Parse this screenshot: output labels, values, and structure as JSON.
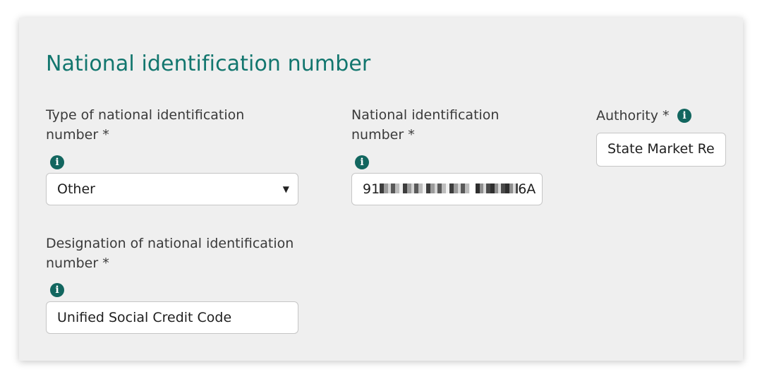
{
  "section": {
    "title": "National identification number"
  },
  "fields": {
    "type": {
      "label_line1": "Type of national identification",
      "label_line2": "number *",
      "info_icon": "info-icon",
      "value": "Other",
      "dropdown_icon": "caret-down-icon"
    },
    "number": {
      "label_line1": "National identification",
      "label_line2": "number *",
      "info_icon": "info-icon",
      "value_prefix": "91",
      "value_suffix": "6A"
    },
    "authority": {
      "label": "Authority *",
      "info_icon": "info-icon",
      "value": "State Market Re"
    },
    "designation": {
      "label_line1": "Designation of national identification",
      "label_line2": "number *",
      "info_icon": "info-icon",
      "value": "Unified Social Credit Code"
    }
  },
  "colors": {
    "title": "#12766e",
    "icon": "#12665f",
    "panel": "#efefef"
  }
}
